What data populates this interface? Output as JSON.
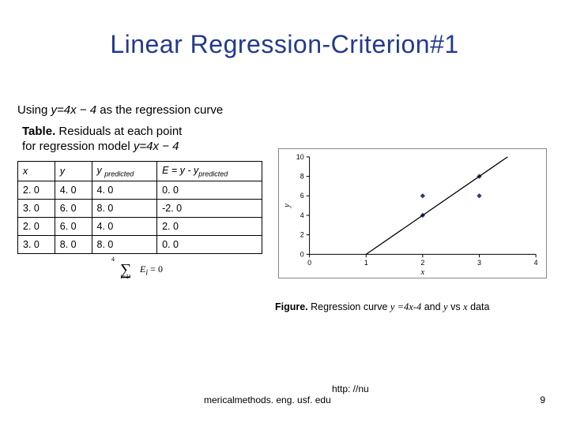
{
  "title": "Linear Regression-Criterion#1",
  "using": {
    "prefix": "Using ",
    "eqn": "y=4x − 4",
    "suffix": " as the regression curve"
  },
  "table_caption": {
    "bold": "Table.",
    "line1": " Residuals at each point",
    "line2_pre": "for regression model ",
    "line2_eqn": "y=4x − 4"
  },
  "table": {
    "headers": {
      "c1": "x",
      "c2": "y",
      "c3_pre": "y ",
      "c3_sub": "predicted",
      "c4_pre": "E = y - y",
      "c4_sub": "predicted"
    },
    "rows": [
      {
        "x": "2. 0",
        "y": "4. 0",
        "yp": "4. 0",
        "e": "0. 0"
      },
      {
        "x": "3. 0",
        "y": "6. 0",
        "yp": "8. 0",
        "e": "-2. 0"
      },
      {
        "x": "2. 0",
        "y": "6. 0",
        "yp": "4. 0",
        "e": "2. 0"
      },
      {
        "x": "3. 0",
        "y": "8. 0",
        "yp": "8. 0",
        "e": "0. 0"
      }
    ]
  },
  "sum_text": "∑ Eᵢ = 0",
  "figure_caption": {
    "bold": "Figure.",
    "t1": " Regression curve ",
    "e1": "y =4x-4",
    "t2": " and ",
    "e2": "y",
    "t3": " vs ",
    "e3": "x",
    "t4": " data"
  },
  "chart_data": {
    "type": "scatter+line",
    "title": "",
    "xlabel": "x",
    "ylabel": "y",
    "xlim": [
      0,
      4
    ],
    "ylim": [
      0,
      10
    ],
    "xticks": [
      0,
      1,
      2,
      3,
      4
    ],
    "yticks": [
      0,
      2,
      4,
      6,
      8,
      10
    ],
    "series": [
      {
        "name": "data",
        "kind": "scatter",
        "points": [
          {
            "x": 2.0,
            "y": 4.0
          },
          {
            "x": 3.0,
            "y": 6.0
          },
          {
            "x": 2.0,
            "y": 6.0
          },
          {
            "x": 3.0,
            "y": 8.0
          }
        ]
      },
      {
        "name": "y=4x-4",
        "kind": "line",
        "points": [
          {
            "x": 1.0,
            "y": 0.0
          },
          {
            "x": 3.5,
            "y": 10.0
          }
        ]
      }
    ]
  },
  "footer": {
    "url1": "http: //nu",
    "url2": "mericalmethods. eng. usf. edu",
    "page": "9"
  }
}
